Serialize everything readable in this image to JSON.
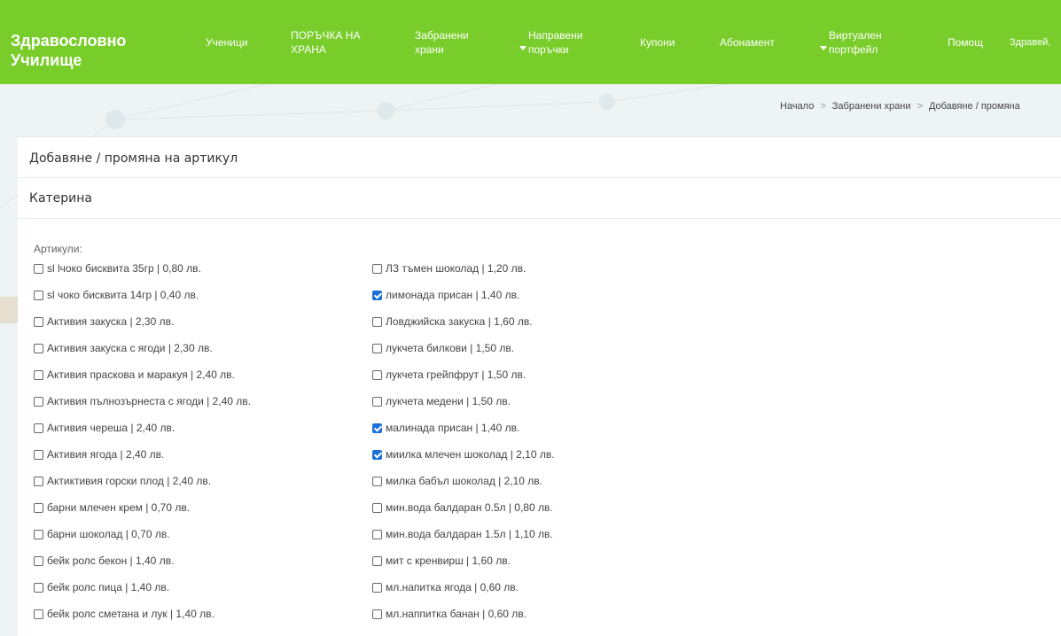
{
  "navbar": {
    "brand": "Здравословно Училище",
    "items": [
      {
        "label": "Ученици",
        "dropdown": false
      },
      {
        "label": "ПОРЪЧКА НА ХРАНА",
        "dropdown": false
      },
      {
        "label": "Забранени храни",
        "dropdown": false
      },
      {
        "label": "Направени поръчки",
        "dropdown": true
      },
      {
        "label": "Купони",
        "dropdown": false
      },
      {
        "label": "Абонамент",
        "dropdown": false
      },
      {
        "label": "Виртуален портфейл",
        "dropdown": true
      },
      {
        "label": "Помощ",
        "dropdown": false
      },
      {
        "label": "Здравей,",
        "dropdown": false
      }
    ]
  },
  "breadcrumb": [
    "Начало",
    "Забранени храни",
    "Добавяне / промяна"
  ],
  "card": {
    "title": "Добавяне / промяна на артикул",
    "subtitle": "Катерина",
    "articles_label": "Артикули:"
  },
  "articles_left": [
    {
      "label": "sl lчоко бисквита 35гр | 0,80 лв.",
      "checked": false
    },
    {
      "label": "sl чоко бисквита 14гр | 0,40 лв.",
      "checked": false
    },
    {
      "label": "Активия закуска | 2,30 лв.",
      "checked": false
    },
    {
      "label": "Активия закуска с ягоди | 2,30 лв.",
      "checked": false
    },
    {
      "label": "Активия праскова и маракуя | 2,40 лв.",
      "checked": false
    },
    {
      "label": "Активия пълнозърнеста с ягоди | 2,40 лв.",
      "checked": false
    },
    {
      "label": "Активия череша | 2,40 лв.",
      "checked": false
    },
    {
      "label": "Активия ягода | 2,40 лв.",
      "checked": false
    },
    {
      "label": "Актиктивия горски плод | 2,40 лв.",
      "checked": false
    },
    {
      "label": "барни млечен крем | 0,70 лв.",
      "checked": false
    },
    {
      "label": "барни шоколад | 0,70 лв.",
      "checked": false
    },
    {
      "label": "бейк ролс бекон | 1,40 лв.",
      "checked": false
    },
    {
      "label": "бейк ролс пица | 1,40 лв.",
      "checked": false
    },
    {
      "label": "бейк ролс сметана и лук | 1,40 лв.",
      "checked": false
    }
  ],
  "articles_right": [
    {
      "label": "ЛЗ тъмен шоколад | 1,20 лв.",
      "checked": false
    },
    {
      "label": "лимонада присан | 1,40 лв.",
      "checked": true
    },
    {
      "label": "Ловджийска закуска | 1,60 лв.",
      "checked": false
    },
    {
      "label": "лукчета билкови | 1,50 лв.",
      "checked": false
    },
    {
      "label": "лукчета грейпфрут | 1,50 лв.",
      "checked": false
    },
    {
      "label": "лукчета медени | 1,50 лв.",
      "checked": false
    },
    {
      "label": "малинада присан | 1,40 лв.",
      "checked": true
    },
    {
      "label": "миилка млечен шоколад | 2,10 лв.",
      "checked": true
    },
    {
      "label": "милка бабъл шоколад | 2,10 лв.",
      "checked": false
    },
    {
      "label": "мин.вода балдаран 0.5л | 0,80 лв.",
      "checked": false
    },
    {
      "label": "мин.вода балдаран 1.5л | 1,10 лв.",
      "checked": false
    },
    {
      "label": "мит с кренвирш | 1,60 лв.",
      "checked": false
    },
    {
      "label": "мл.напитка ягода | 0,60 лв.",
      "checked": false
    },
    {
      "label": "мл.наппитка банан | 0,60 лв.",
      "checked": false
    }
  ],
  "colors": {
    "navbar": "#79cd2a",
    "checkbox_checked": "#1b6fd9"
  }
}
